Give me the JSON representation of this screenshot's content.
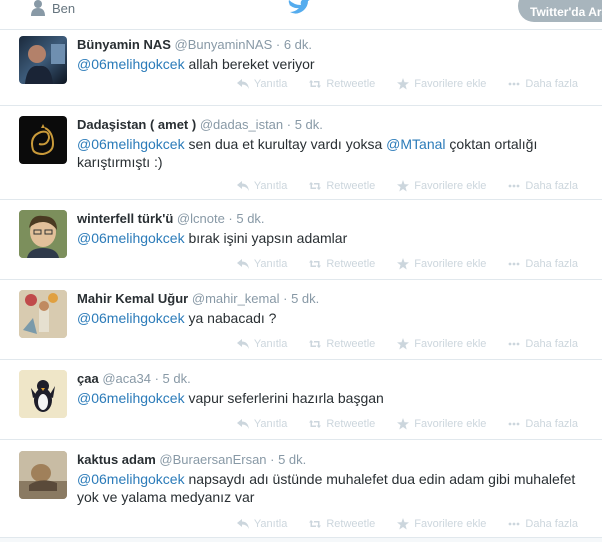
{
  "topbar": {
    "me_label": "Ben",
    "search_label": "Twitter'da Ara"
  },
  "actions": {
    "reply": "Yanıtla",
    "retweet": "Retweetle",
    "favorite": "Favorilere ekle",
    "more": "Daha fazla"
  },
  "tweets": [
    {
      "name": "Bünyamin NAS",
      "handle": "@BunyaminNAS",
      "time": "6 dk.",
      "mention1": "@06melihgokcek",
      "text1": " allah bereket veriyor",
      "mention2": "",
      "text2": "",
      "line2": ""
    },
    {
      "name": "Dadaşistan ( amet )",
      "handle": "@dadas_istan",
      "time": "5 dk.",
      "mention1": "@06melihgokcek",
      "text1": "  sen dua et kurultay vardı yoksa ",
      "mention2": "@MTanal",
      "text2": "  çoktan ortalığı",
      "line2": "karıştırmıştı :)"
    },
    {
      "name": "winterfell türk'ü",
      "handle": "@lcnote",
      "time": "5 dk.",
      "mention1": "@06melihgokcek",
      "text1": " bırak işini yapsın adamlar",
      "mention2": "",
      "text2": "",
      "line2": ""
    },
    {
      "name": "Mahir Kemal Uğur",
      "handle": "@mahir_kemal",
      "time": "5 dk.",
      "mention1": "@06melihgokcek",
      "text1": "  ya nabacadı ?",
      "mention2": "",
      "text2": "",
      "line2": ""
    },
    {
      "name": "çaa",
      "handle": "@aca34",
      "time": "5 dk.",
      "mention1": "@06melihgokcek",
      "text1": " vapur seferlerini hazırla başgan",
      "mention2": "",
      "text2": "",
      "line2": ""
    },
    {
      "name": "kaktus adam",
      "handle": "@BuraersanErsan",
      "time": "5 dk.",
      "mention1": "@06melihgokcek",
      "text1": " napsaydı adı üstünde muhalefet dua edin adam gibi muhalefet",
      "mention2": "",
      "text2": "",
      "line2": "yok ve yalama medyanız var"
    }
  ],
  "colors": {
    "link": "#2b7bb9",
    "muted": "#8899a6",
    "action": "#ccd6dd",
    "brand": "#55acee"
  },
  "icons": [
    "user-icon",
    "twitter-bird-icon",
    "reply-icon",
    "retweet-icon",
    "star-icon",
    "more-icon"
  ]
}
